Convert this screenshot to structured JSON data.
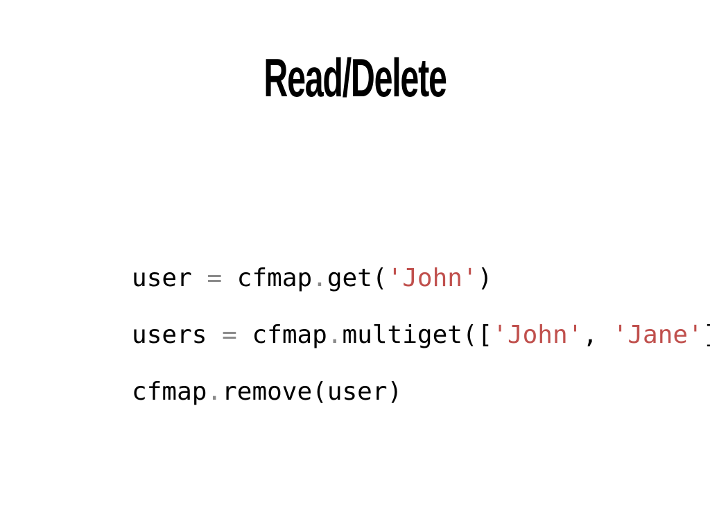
{
  "slide": {
    "title": "Read/Delete",
    "code_lines": [
      [
        {
          "text": "user",
          "kind": "plain"
        },
        {
          "text": " ",
          "kind": "plain"
        },
        {
          "text": "=",
          "kind": "op"
        },
        {
          "text": " cfmap",
          "kind": "plain"
        },
        {
          "text": ".",
          "kind": "op"
        },
        {
          "text": "get(",
          "kind": "plain"
        },
        {
          "text": "'John'",
          "kind": "str"
        },
        {
          "text": ")",
          "kind": "plain"
        }
      ],
      [
        {
          "text": "users",
          "kind": "plain"
        },
        {
          "text": " ",
          "kind": "plain"
        },
        {
          "text": "=",
          "kind": "op"
        },
        {
          "text": " cfmap",
          "kind": "plain"
        },
        {
          "text": ".",
          "kind": "op"
        },
        {
          "text": "multiget([",
          "kind": "plain"
        },
        {
          "text": "'John'",
          "kind": "str"
        },
        {
          "text": ", ",
          "kind": "plain"
        },
        {
          "text": "'Jane'",
          "kind": "str"
        },
        {
          "text": "])",
          "kind": "plain"
        }
      ],
      [
        {
          "text": "cfmap",
          "kind": "plain"
        },
        {
          "text": ".",
          "kind": "op"
        },
        {
          "text": "remove(user)",
          "kind": "plain"
        }
      ]
    ]
  },
  "colors": {
    "background": "#ffffff",
    "text": "#000000",
    "operator": "#8a8a8a",
    "string": "#c0504d"
  }
}
